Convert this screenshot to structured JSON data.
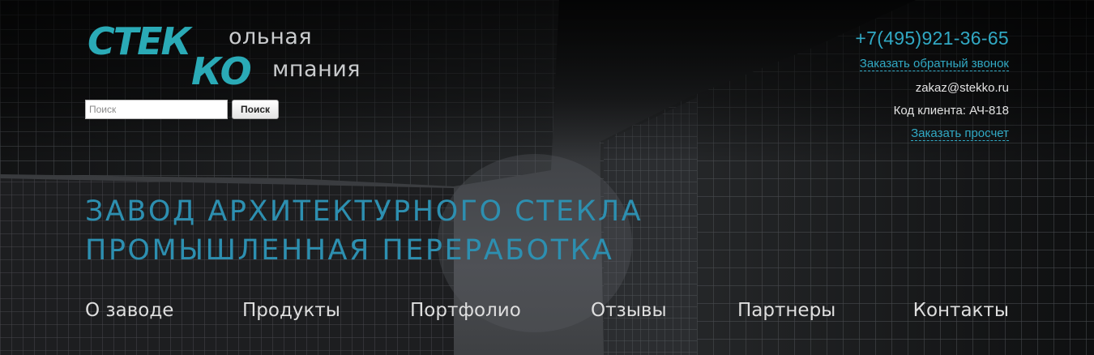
{
  "logo": {
    "part1_main": "СТЕК",
    "part1_tail": "ольная",
    "part2_main": "КО",
    "part2_tail": "мпания"
  },
  "search": {
    "placeholder": "Поиск",
    "value": "",
    "button_label": "Поиск"
  },
  "contacts": {
    "phone": "+7(495)921-36-65",
    "callback_label": "Заказать обратный звонок",
    "email": "zakaz@stekko.ru",
    "client_code": "Код клиента: АЧ-818",
    "quote_label": "Заказать просчет"
  },
  "hero": {
    "line1": "ЗАВОД АРХИТЕКТУРНОГО СТЕКЛА",
    "line2": "ПРОМЫШЛЕННАЯ ПЕРЕРАБОТКА"
  },
  "nav": {
    "items": [
      {
        "label": "О заводе"
      },
      {
        "label": "Продукты"
      },
      {
        "label": "Портфолио"
      },
      {
        "label": "Отзывы"
      },
      {
        "label": "Партнеры"
      },
      {
        "label": "Контакты"
      }
    ]
  },
  "colors": {
    "accent": "#2aaab6",
    "link": "#31a9c4",
    "headline": "#2d8fb0",
    "nav_text": "#dedede"
  }
}
